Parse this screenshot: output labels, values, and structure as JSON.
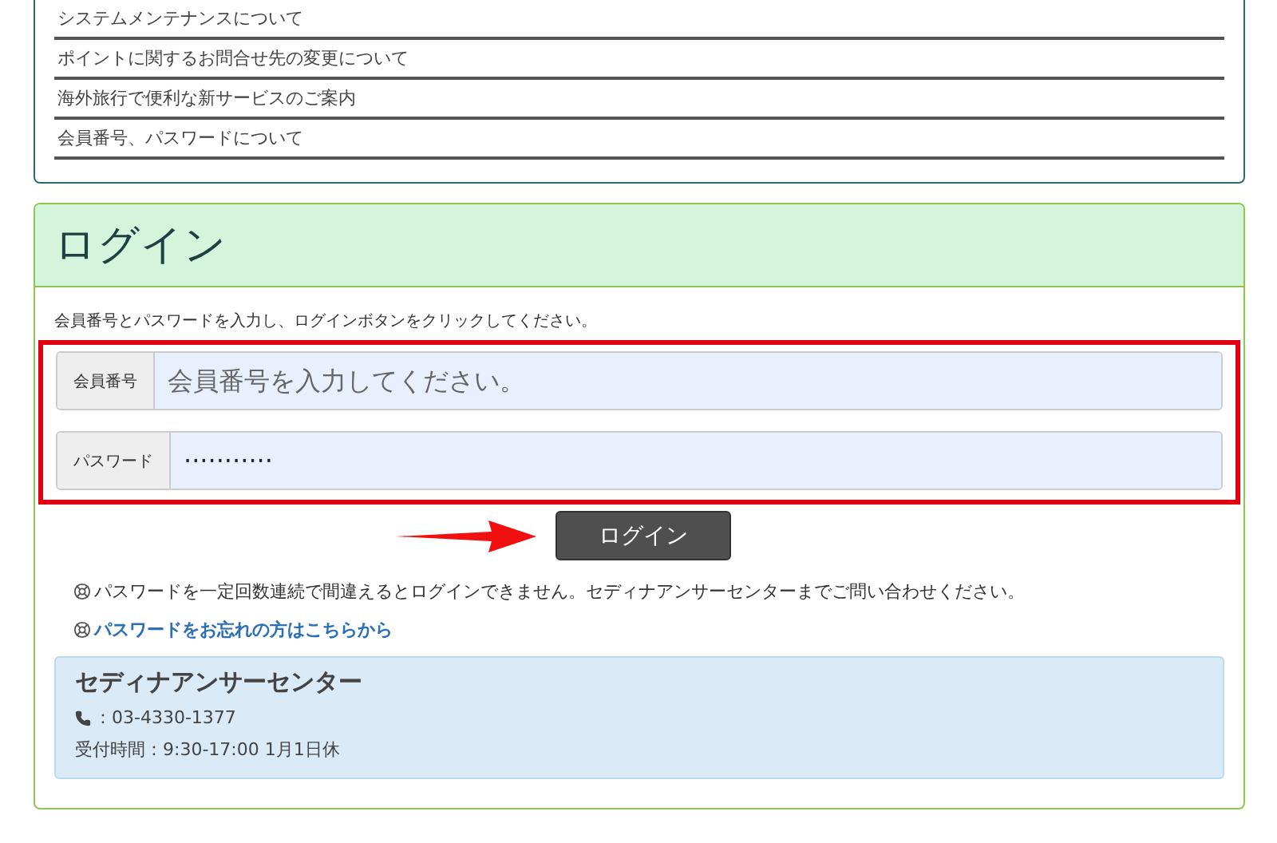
{
  "news": {
    "items": [
      "システムメンテナンスについて",
      "ポイントに関するお問合せ先の変更について",
      "海外旅行で便利な新サービスのご案内",
      "会員番号、パスワードについて"
    ]
  },
  "login": {
    "title": "ログイン",
    "instruction": "会員番号とパスワードを入力し、ログインボタンをクリックしてください。",
    "fields": [
      {
        "label": "会員番号",
        "placeholder": "会員番号を入力してください。"
      },
      {
        "label": "パスワード",
        "value": "···········"
      }
    ],
    "button": "ログイン",
    "notice": "パスワードを一定回数連続で間違えるとログインできません。セディナアンサーセンターまでご問い合わせください。",
    "forgot_link": "パスワードをお忘れの方はこちらから",
    "contact": {
      "title": "セディナアンサーセンター",
      "phone": "：03-4330-1377",
      "hours": "受付時間：9:30-17:00 1月1日休"
    }
  }
}
